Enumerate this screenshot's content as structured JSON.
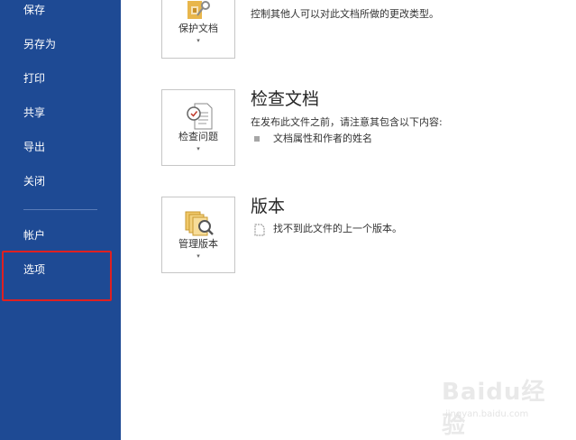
{
  "sidebar": {
    "items": [
      {
        "label": "保存"
      },
      {
        "label": "另存为"
      },
      {
        "label": "打印"
      },
      {
        "label": "共享"
      },
      {
        "label": "导出"
      },
      {
        "label": "关闭"
      },
      {
        "label": "帐户"
      },
      {
        "label": "选项"
      }
    ]
  },
  "protect": {
    "tile_label": "保护文档",
    "description": "控制其他人可以对此文档所做的更改类型。"
  },
  "inspect": {
    "tile_label": "检查问题",
    "title": "检查文档",
    "description": "在发布此文件之前，请注意其包含以下内容:",
    "bullet": "文档属性和作者的姓名"
  },
  "versions": {
    "tile_label": "管理版本",
    "title": "版本",
    "description": "找不到此文件的上一个版本。"
  },
  "caret": "▾",
  "watermark": {
    "logo": "Baidu经验",
    "url": "jingyan.baidu.com"
  },
  "colors": {
    "sidebar_bg": "#1e4a94",
    "highlight": "#e02020"
  }
}
